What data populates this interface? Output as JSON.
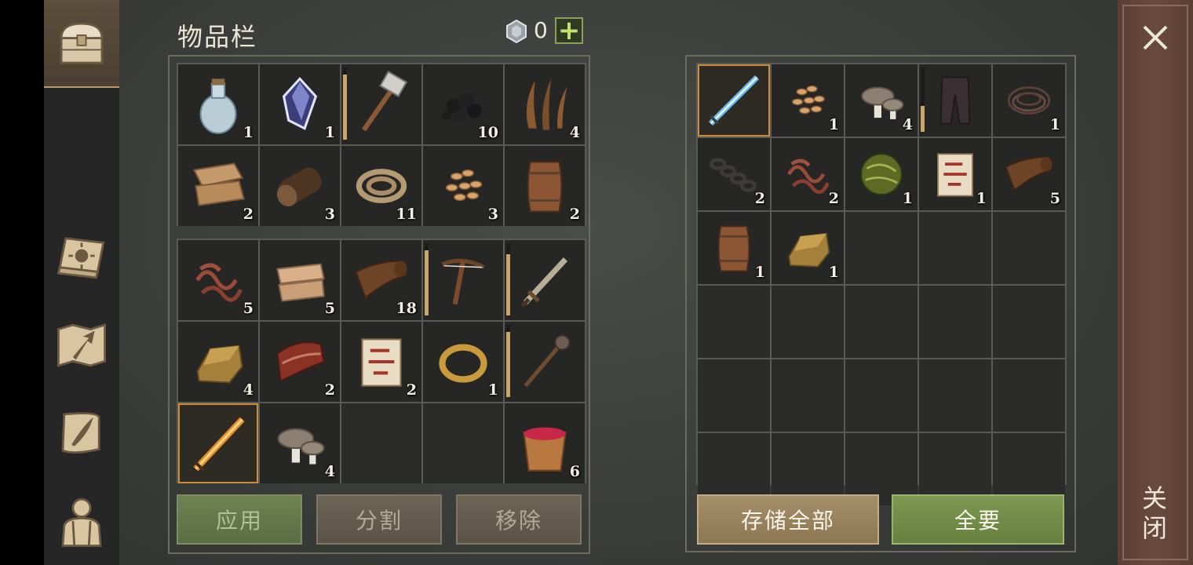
{
  "title": "物品栏",
  "currency": {
    "icon": "gem-icon",
    "count": "0",
    "add_icon": "plus-icon"
  },
  "nav": [
    {
      "icon": "chest-icon",
      "active": true
    },
    {
      "icon": "sun-book-icon",
      "active": false
    },
    {
      "icon": "map-arrow-icon",
      "active": false
    },
    {
      "icon": "scroll-feather-icon",
      "active": false
    },
    {
      "icon": "character-icon",
      "active": false
    }
  ],
  "inventory_quick": [
    {
      "item": "water-bottle",
      "qty": "1"
    },
    {
      "item": "crystal",
      "qty": "1"
    },
    {
      "item": "stone-hammer",
      "qty": "",
      "durability": 0.9
    },
    {
      "item": "coal",
      "qty": "10"
    },
    {
      "item": "dried-leaves",
      "qty": "4"
    },
    {
      "item": "fabric",
      "qty": "2"
    },
    {
      "item": "log",
      "qty": "3"
    },
    {
      "item": "rope",
      "qty": "11"
    },
    {
      "item": "seeds",
      "qty": "3"
    },
    {
      "item": "barrel",
      "qty": "2"
    }
  ],
  "inventory_bag": [
    {
      "item": "worms",
      "qty": "5"
    },
    {
      "item": "cloth-roll",
      "qty": "5"
    },
    {
      "item": "leather",
      "qty": "18"
    },
    {
      "item": "crossbow",
      "qty": "",
      "durability": 0.9
    },
    {
      "item": "sword",
      "qty": "",
      "durability": 0.85
    },
    {
      "item": "ingot",
      "qty": "4"
    },
    {
      "item": "meat",
      "qty": "2"
    },
    {
      "item": "recipe-scroll",
      "qty": "2"
    },
    {
      "item": "gold-ring",
      "qty": "1"
    },
    {
      "item": "mace",
      "qty": "",
      "durability": 0.9
    },
    {
      "item": "fire-sword",
      "qty": "",
      "highlight": true
    },
    {
      "item": "mushrooms",
      "qty": "4"
    },
    {
      "item": "",
      "qty": ""
    },
    {
      "item": "",
      "qty": ""
    },
    {
      "item": "berry-bucket",
      "qty": "6"
    }
  ],
  "storage": [
    {
      "item": "ice-sword",
      "qty": "",
      "highlight": true
    },
    {
      "item": "seeds",
      "qty": "1"
    },
    {
      "item": "mushrooms",
      "qty": "4"
    },
    {
      "item": "pants",
      "qty": "",
      "durability": 0.4
    },
    {
      "item": "wire",
      "qty": "1"
    },
    {
      "item": "chain",
      "qty": "2"
    },
    {
      "item": "worms",
      "qty": "2"
    },
    {
      "item": "grass-ball",
      "qty": "1"
    },
    {
      "item": "recipe-scroll",
      "qty": "1"
    },
    {
      "item": "leather",
      "qty": "5"
    },
    {
      "item": "barrel",
      "qty": "1"
    },
    {
      "item": "ingot",
      "qty": "1"
    },
    {
      "item": "",
      "qty": ""
    },
    {
      "item": "",
      "qty": ""
    },
    {
      "item": "",
      "qty": ""
    },
    {
      "item": "",
      "qty": ""
    },
    {
      "item": "",
      "qty": ""
    },
    {
      "item": "",
      "qty": ""
    },
    {
      "item": "",
      "qty": ""
    },
    {
      "item": "",
      "qty": ""
    },
    {
      "item": "",
      "qty": ""
    },
    {
      "item": "",
      "qty": ""
    },
    {
      "item": "",
      "qty": ""
    },
    {
      "item": "",
      "qty": ""
    },
    {
      "item": "",
      "qty": ""
    },
    {
      "item": "",
      "qty": ""
    },
    {
      "item": "",
      "qty": ""
    },
    {
      "item": "",
      "qty": ""
    },
    {
      "item": "",
      "qty": ""
    },
    {
      "item": "",
      "qty": ""
    }
  ],
  "buttons": {
    "apply": "应用",
    "split": "分割",
    "remove": "移除",
    "store_all": "存储全部",
    "take_all": "全要"
  },
  "close": {
    "label": "关闭",
    "icon": "close-icon"
  },
  "colors": {
    "accent_green": "#7d9852",
    "highlight_orange": "#d08a3c",
    "panel_red": "#6a4a3d"
  }
}
